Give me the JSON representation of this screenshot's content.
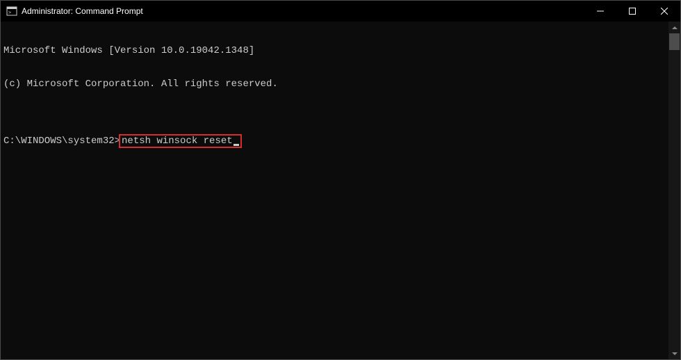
{
  "window": {
    "title": "Administrator: Command Prompt"
  },
  "terminal": {
    "line1": "Microsoft Windows [Version 10.0.19042.1348]",
    "line2": "(c) Microsoft Corporation. All rights reserved.",
    "blank": "",
    "prompt": "C:\\WINDOWS\\system32>",
    "command": "netsh winsock reset"
  }
}
